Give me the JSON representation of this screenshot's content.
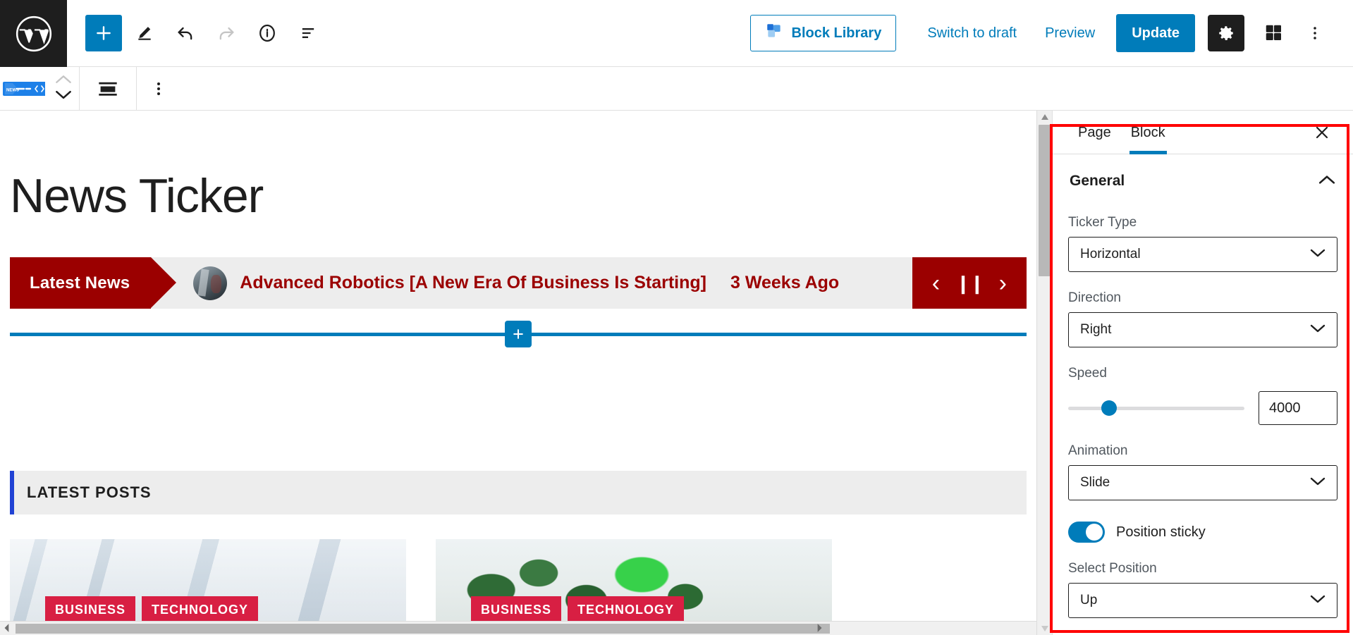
{
  "toolbar": {
    "logo_icon": "wordpress-logo-icon",
    "add_label": "+",
    "add_icon": "plus-icon",
    "edit_icon": "pencil-icon",
    "undo_icon": "undo-arrow-icon",
    "redo_icon": "redo-arrow-icon",
    "info_icon": "info-circle-icon",
    "listview_icon": "list-view-icon",
    "block_library_label": "Block Library",
    "block_library_icon": "blocks-stack-icon",
    "switch_to_draft_label": "Switch to draft",
    "preview_label": "Preview",
    "update_label": "Update",
    "settings_icon": "gear-icon",
    "blocks_icon": "blocks-icon",
    "more_icon": "three-dots-vertical-icon"
  },
  "block_toolbar": {
    "block_type_icon": "news-ticker-block-icon",
    "move_up_icon": "chevron-up-icon",
    "move_down_icon": "chevron-down-icon",
    "align_icon": "align-center-icon",
    "options_icon": "three-dots-vertical-icon"
  },
  "editor": {
    "page_title": "News Ticker",
    "ticker": {
      "label": "Latest News",
      "headline": "Advanced Robotics [A New Era Of Business Is Starting]",
      "date": "3 Weeks Ago",
      "prev_icon": "chevron-left-icon",
      "pause_icon": "pause-icon",
      "next_icon": "chevron-right-icon",
      "accent_color": "#9b0000"
    },
    "inserter": {
      "icon": "plus-icon",
      "color": "#007cba"
    },
    "latest_posts": {
      "heading": "LATEST POSTS",
      "accent_color": "#2142d4",
      "cards": [
        {
          "image": "industrial-facility-photo",
          "tags": [
            "BUSINESS",
            "TECHNOLOGY"
          ]
        },
        {
          "image": "green-plants-photo",
          "tags": [
            "BUSINESS",
            "TECHNOLOGY"
          ]
        }
      ],
      "tag_color": "#d81f43"
    }
  },
  "sidebar": {
    "tabs": [
      {
        "label": "Page",
        "active": false
      },
      {
        "label": "Block",
        "active": true
      }
    ],
    "close_icon": "close-x-icon",
    "panel": {
      "title": "General",
      "collapse_icon": "chevron-up-icon",
      "fields": {
        "ticker_type": {
          "label": "Ticker Type",
          "value": "Horizontal",
          "icon": "chevron-down-icon"
        },
        "direction": {
          "label": "Direction",
          "value": "Right",
          "icon": "chevron-down-icon"
        },
        "speed": {
          "label": "Speed",
          "value": "4000",
          "slider_percent": 23
        },
        "animation": {
          "label": "Animation",
          "value": "Slide",
          "icon": "chevron-down-icon"
        },
        "position_sticky": {
          "label": "Position sticky",
          "enabled": true
        },
        "select_position": {
          "label": "Select Position",
          "value": "Up",
          "icon": "chevron-down-icon"
        }
      }
    }
  },
  "annotation": {
    "color": "#ff0000"
  }
}
